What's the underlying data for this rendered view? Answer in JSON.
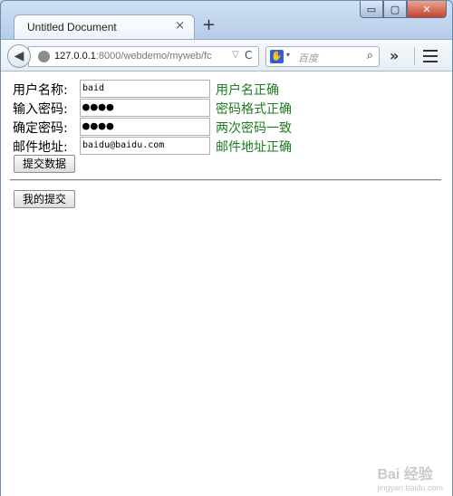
{
  "window": {
    "tab_title": "Untitled Document",
    "tab_close": "×",
    "new_tab": "+",
    "controls": {
      "minimize": "▭",
      "maximize": "▢",
      "close": "✕"
    }
  },
  "navbar": {
    "back": "◀",
    "url_host": "127.0.0.1",
    "url_rest": ":8000/webdemo/myweb/fc",
    "url_dropdown": "▽",
    "reload": "C",
    "search_engine_icon": "paw-icon",
    "search_dropdown": "▾",
    "search_placeholder": "百度",
    "search_icon": "magnifier-icon",
    "overflow": "»",
    "menu_icon": "hamburger-icon"
  },
  "form": {
    "username": {
      "label": "用户名称:",
      "value": "baid",
      "message": "用户名正确"
    },
    "password": {
      "label": "输入密码:",
      "value": "●●●●",
      "message": "密码格式正确"
    },
    "confirm": {
      "label": "确定密码:",
      "value": "●●●●",
      "message": "两次密码一致"
    },
    "email": {
      "label": "邮件地址:",
      "value": "baidu@baidu.com",
      "message": "邮件地址正确"
    },
    "submit_label": "提交数据",
    "message_color": "#1d7c1d"
  },
  "my_submit_label": "我的提交",
  "watermark": {
    "main": "Bai 经验",
    "sub": "jingyan.baidu.com"
  }
}
